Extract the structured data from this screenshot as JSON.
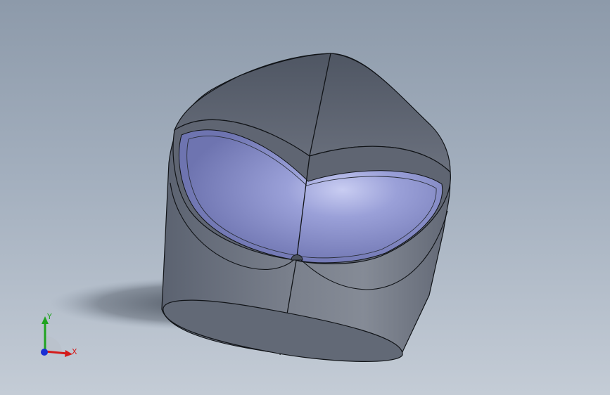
{
  "viewport": {
    "background_top": "#8d9aaa",
    "background_bottom": "#c4ccd6"
  },
  "model": {
    "body_color": "#6e7582",
    "face_color": "#8a90c8",
    "edge_color": "#111418"
  },
  "triad": {
    "x_label": "X",
    "y_label": "Y",
    "x_color": "#d41a1a",
    "y_color": "#1fa31f",
    "z_color": "#1a2fd4"
  }
}
